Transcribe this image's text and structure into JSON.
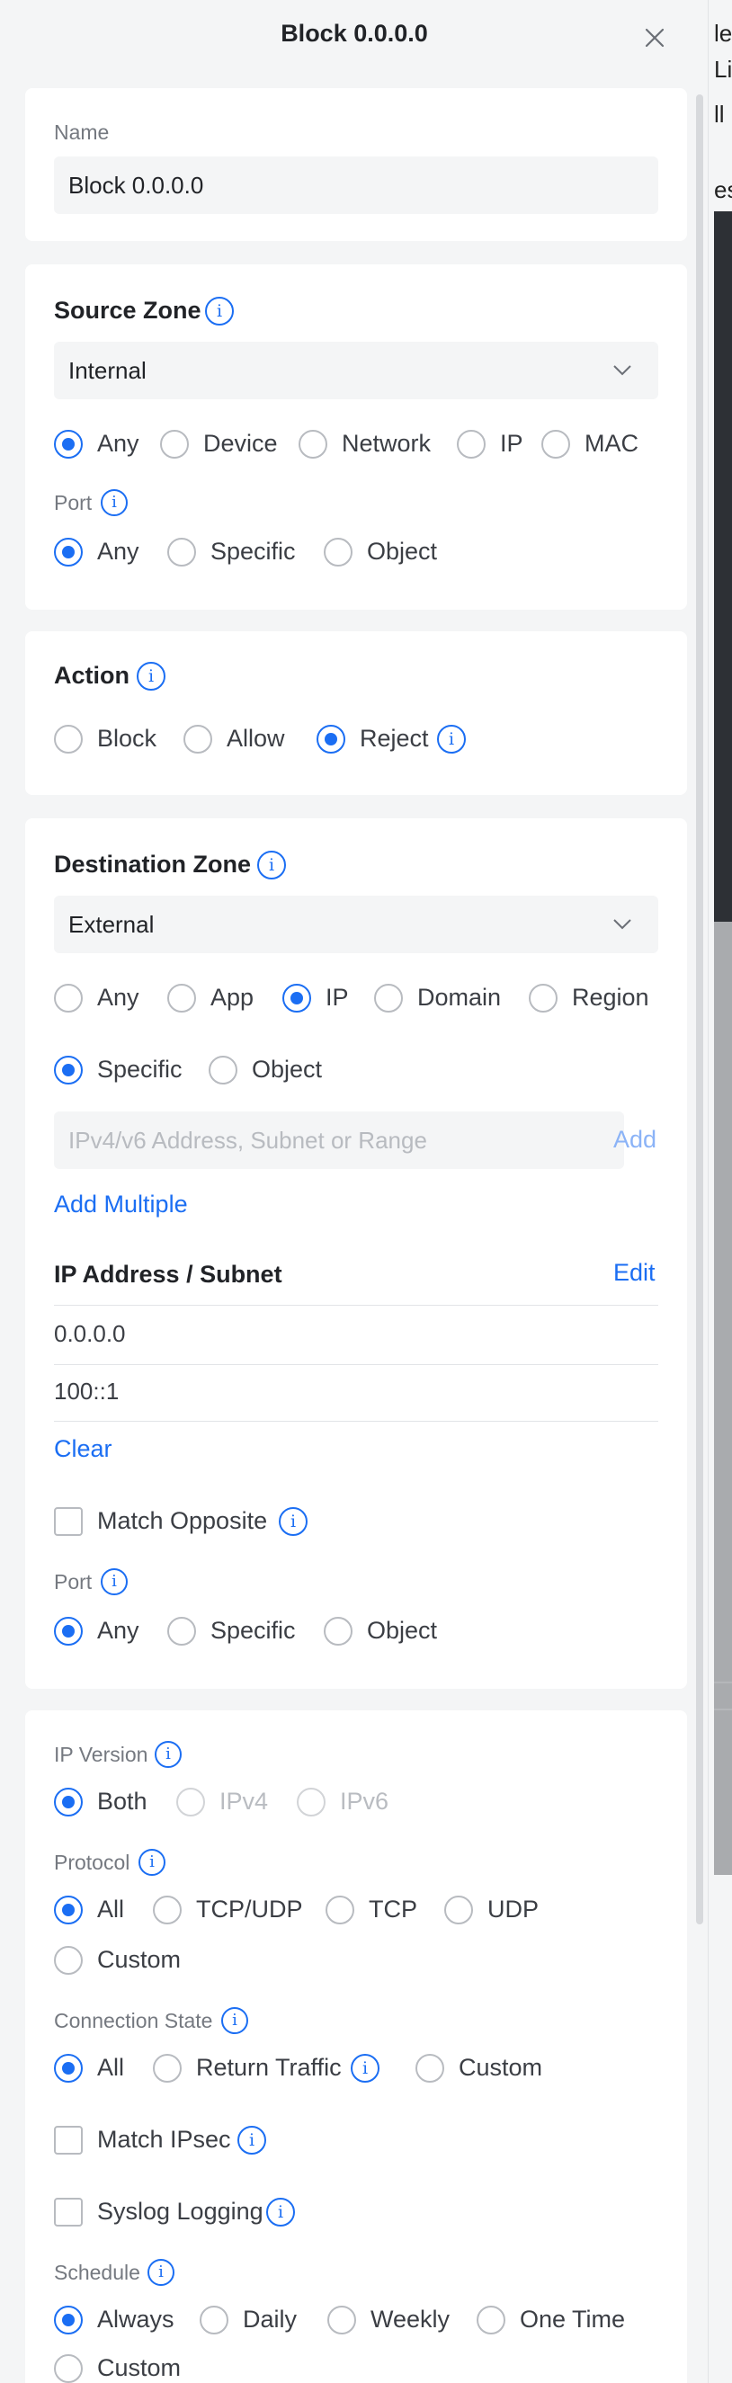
{
  "window": {
    "title": "Block 0.0.0.0"
  },
  "background_fragment": [
    "le",
    "Li",
    "ll",
    "es"
  ],
  "name_section": {
    "label": "Name",
    "value": "Block 0.0.0.0"
  },
  "source_zone": {
    "title": "Source Zone",
    "selected_zone": "Internal",
    "options": [
      "Any",
      "Device",
      "Network",
      "IP",
      "MAC"
    ],
    "selected_option": "Any",
    "port": {
      "label": "Port",
      "options": [
        "Any",
        "Specific",
        "Object"
      ],
      "selected": "Any"
    }
  },
  "action": {
    "title": "Action",
    "options": [
      "Block",
      "Allow",
      "Reject"
    ],
    "selected": "Reject"
  },
  "destination_zone": {
    "title": "Destination Zone",
    "selected_zone": "External",
    "options": [
      "Any",
      "App",
      "IP",
      "Domain",
      "Region"
    ],
    "selected_option": "IP",
    "ip_mode": {
      "options": [
        "Specific",
        "Object"
      ],
      "selected": "Specific"
    },
    "ip_input_placeholder": "IPv4/v6 Address, Subnet or Range",
    "add_label": "Add",
    "add_multiple_label": "Add Multiple",
    "list_title": "IP Address / Subnet",
    "edit_label": "Edit",
    "addresses": [
      "0.0.0.0",
      "100::1"
    ],
    "clear_label": "Clear",
    "match_opposite_label": "Match Opposite",
    "match_opposite_checked": false,
    "port": {
      "label": "Port",
      "options": [
        "Any",
        "Specific",
        "Object"
      ],
      "selected": "Any"
    }
  },
  "advanced": {
    "ip_version": {
      "label": "IP Version",
      "options": [
        "Both",
        "IPv4",
        "IPv6"
      ],
      "selected": "Both",
      "disabled": [
        "IPv4",
        "IPv6"
      ]
    },
    "protocol": {
      "label": "Protocol",
      "options": [
        "All",
        "TCP/UDP",
        "TCP",
        "UDP",
        "Custom"
      ],
      "selected": "All"
    },
    "connection_state": {
      "label": "Connection State",
      "options": [
        "All",
        "Return Traffic",
        "Custom"
      ],
      "selected": "All"
    },
    "match_ipsec": {
      "label": "Match IPsec",
      "checked": false
    },
    "syslog_logging": {
      "label": "Syslog Logging",
      "checked": false
    },
    "schedule": {
      "label": "Schedule",
      "options": [
        "Always",
        "Daily",
        "Weekly",
        "One Time",
        "Custom"
      ],
      "selected": "Always"
    }
  },
  "colors": {
    "accent": "#1b6ef3",
    "page_bg": "#f4f5f6",
    "card_bg": "#ffffff",
    "text": "#212327",
    "muted": "#757980"
  }
}
